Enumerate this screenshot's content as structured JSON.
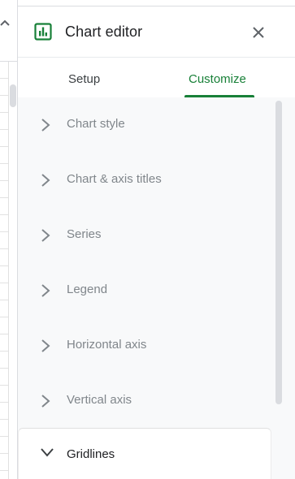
{
  "panel": {
    "title": "Chart editor",
    "title_icon": "bar-chart-icon",
    "close_icon": "close-icon",
    "accent_color": "#188038"
  },
  "tabs": [
    {
      "label": "Setup",
      "active": false
    },
    {
      "label": "Customize",
      "active": true
    }
  ],
  "sections": [
    {
      "label": "Chart style",
      "expanded": false
    },
    {
      "label": "Chart & axis titles",
      "expanded": false
    },
    {
      "label": "Series",
      "expanded": false
    },
    {
      "label": "Legend",
      "expanded": false
    },
    {
      "label": "Horizontal axis",
      "expanded": false
    },
    {
      "label": "Vertical axis",
      "expanded": false
    },
    {
      "label": "Gridlines",
      "expanded": true
    }
  ]
}
